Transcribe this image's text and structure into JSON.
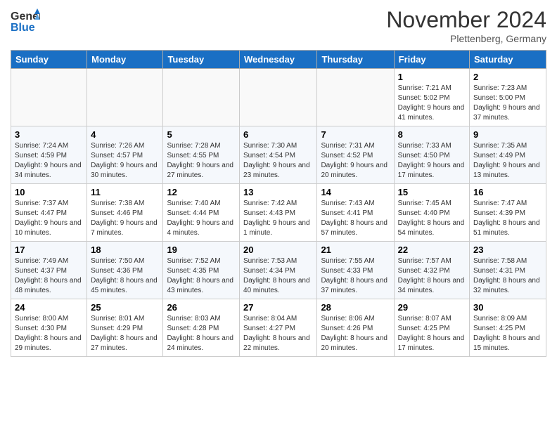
{
  "header": {
    "logo_general": "General",
    "logo_blue": "Blue",
    "title": "November 2024",
    "location": "Plettenberg, Germany"
  },
  "days_of_week": [
    "Sunday",
    "Monday",
    "Tuesday",
    "Wednesday",
    "Thursday",
    "Friday",
    "Saturday"
  ],
  "weeks": [
    [
      {
        "day": "",
        "info": ""
      },
      {
        "day": "",
        "info": ""
      },
      {
        "day": "",
        "info": ""
      },
      {
        "day": "",
        "info": ""
      },
      {
        "day": "",
        "info": ""
      },
      {
        "day": "1",
        "info": "Sunrise: 7:21 AM\nSunset: 5:02 PM\nDaylight: 9 hours and 41 minutes."
      },
      {
        "day": "2",
        "info": "Sunrise: 7:23 AM\nSunset: 5:00 PM\nDaylight: 9 hours and 37 minutes."
      }
    ],
    [
      {
        "day": "3",
        "info": "Sunrise: 7:24 AM\nSunset: 4:59 PM\nDaylight: 9 hours and 34 minutes."
      },
      {
        "day": "4",
        "info": "Sunrise: 7:26 AM\nSunset: 4:57 PM\nDaylight: 9 hours and 30 minutes."
      },
      {
        "day": "5",
        "info": "Sunrise: 7:28 AM\nSunset: 4:55 PM\nDaylight: 9 hours and 27 minutes."
      },
      {
        "day": "6",
        "info": "Sunrise: 7:30 AM\nSunset: 4:54 PM\nDaylight: 9 hours and 23 minutes."
      },
      {
        "day": "7",
        "info": "Sunrise: 7:31 AM\nSunset: 4:52 PM\nDaylight: 9 hours and 20 minutes."
      },
      {
        "day": "8",
        "info": "Sunrise: 7:33 AM\nSunset: 4:50 PM\nDaylight: 9 hours and 17 minutes."
      },
      {
        "day": "9",
        "info": "Sunrise: 7:35 AM\nSunset: 4:49 PM\nDaylight: 9 hours and 13 minutes."
      }
    ],
    [
      {
        "day": "10",
        "info": "Sunrise: 7:37 AM\nSunset: 4:47 PM\nDaylight: 9 hours and 10 minutes."
      },
      {
        "day": "11",
        "info": "Sunrise: 7:38 AM\nSunset: 4:46 PM\nDaylight: 9 hours and 7 minutes."
      },
      {
        "day": "12",
        "info": "Sunrise: 7:40 AM\nSunset: 4:44 PM\nDaylight: 9 hours and 4 minutes."
      },
      {
        "day": "13",
        "info": "Sunrise: 7:42 AM\nSunset: 4:43 PM\nDaylight: 9 hours and 1 minute."
      },
      {
        "day": "14",
        "info": "Sunrise: 7:43 AM\nSunset: 4:41 PM\nDaylight: 8 hours and 57 minutes."
      },
      {
        "day": "15",
        "info": "Sunrise: 7:45 AM\nSunset: 4:40 PM\nDaylight: 8 hours and 54 minutes."
      },
      {
        "day": "16",
        "info": "Sunrise: 7:47 AM\nSunset: 4:39 PM\nDaylight: 8 hours and 51 minutes."
      }
    ],
    [
      {
        "day": "17",
        "info": "Sunrise: 7:49 AM\nSunset: 4:37 PM\nDaylight: 8 hours and 48 minutes."
      },
      {
        "day": "18",
        "info": "Sunrise: 7:50 AM\nSunset: 4:36 PM\nDaylight: 8 hours and 45 minutes."
      },
      {
        "day": "19",
        "info": "Sunrise: 7:52 AM\nSunset: 4:35 PM\nDaylight: 8 hours and 43 minutes."
      },
      {
        "day": "20",
        "info": "Sunrise: 7:53 AM\nSunset: 4:34 PM\nDaylight: 8 hours and 40 minutes."
      },
      {
        "day": "21",
        "info": "Sunrise: 7:55 AM\nSunset: 4:33 PM\nDaylight: 8 hours and 37 minutes."
      },
      {
        "day": "22",
        "info": "Sunrise: 7:57 AM\nSunset: 4:32 PM\nDaylight: 8 hours and 34 minutes."
      },
      {
        "day": "23",
        "info": "Sunrise: 7:58 AM\nSunset: 4:31 PM\nDaylight: 8 hours and 32 minutes."
      }
    ],
    [
      {
        "day": "24",
        "info": "Sunrise: 8:00 AM\nSunset: 4:30 PM\nDaylight: 8 hours and 29 minutes."
      },
      {
        "day": "25",
        "info": "Sunrise: 8:01 AM\nSunset: 4:29 PM\nDaylight: 8 hours and 27 minutes."
      },
      {
        "day": "26",
        "info": "Sunrise: 8:03 AM\nSunset: 4:28 PM\nDaylight: 8 hours and 24 minutes."
      },
      {
        "day": "27",
        "info": "Sunrise: 8:04 AM\nSunset: 4:27 PM\nDaylight: 8 hours and 22 minutes."
      },
      {
        "day": "28",
        "info": "Sunrise: 8:06 AM\nSunset: 4:26 PM\nDaylight: 8 hours and 20 minutes."
      },
      {
        "day": "29",
        "info": "Sunrise: 8:07 AM\nSunset: 4:25 PM\nDaylight: 8 hours and 17 minutes."
      },
      {
        "day": "30",
        "info": "Sunrise: 8:09 AM\nSunset: 4:25 PM\nDaylight: 8 hours and 15 minutes."
      }
    ]
  ]
}
